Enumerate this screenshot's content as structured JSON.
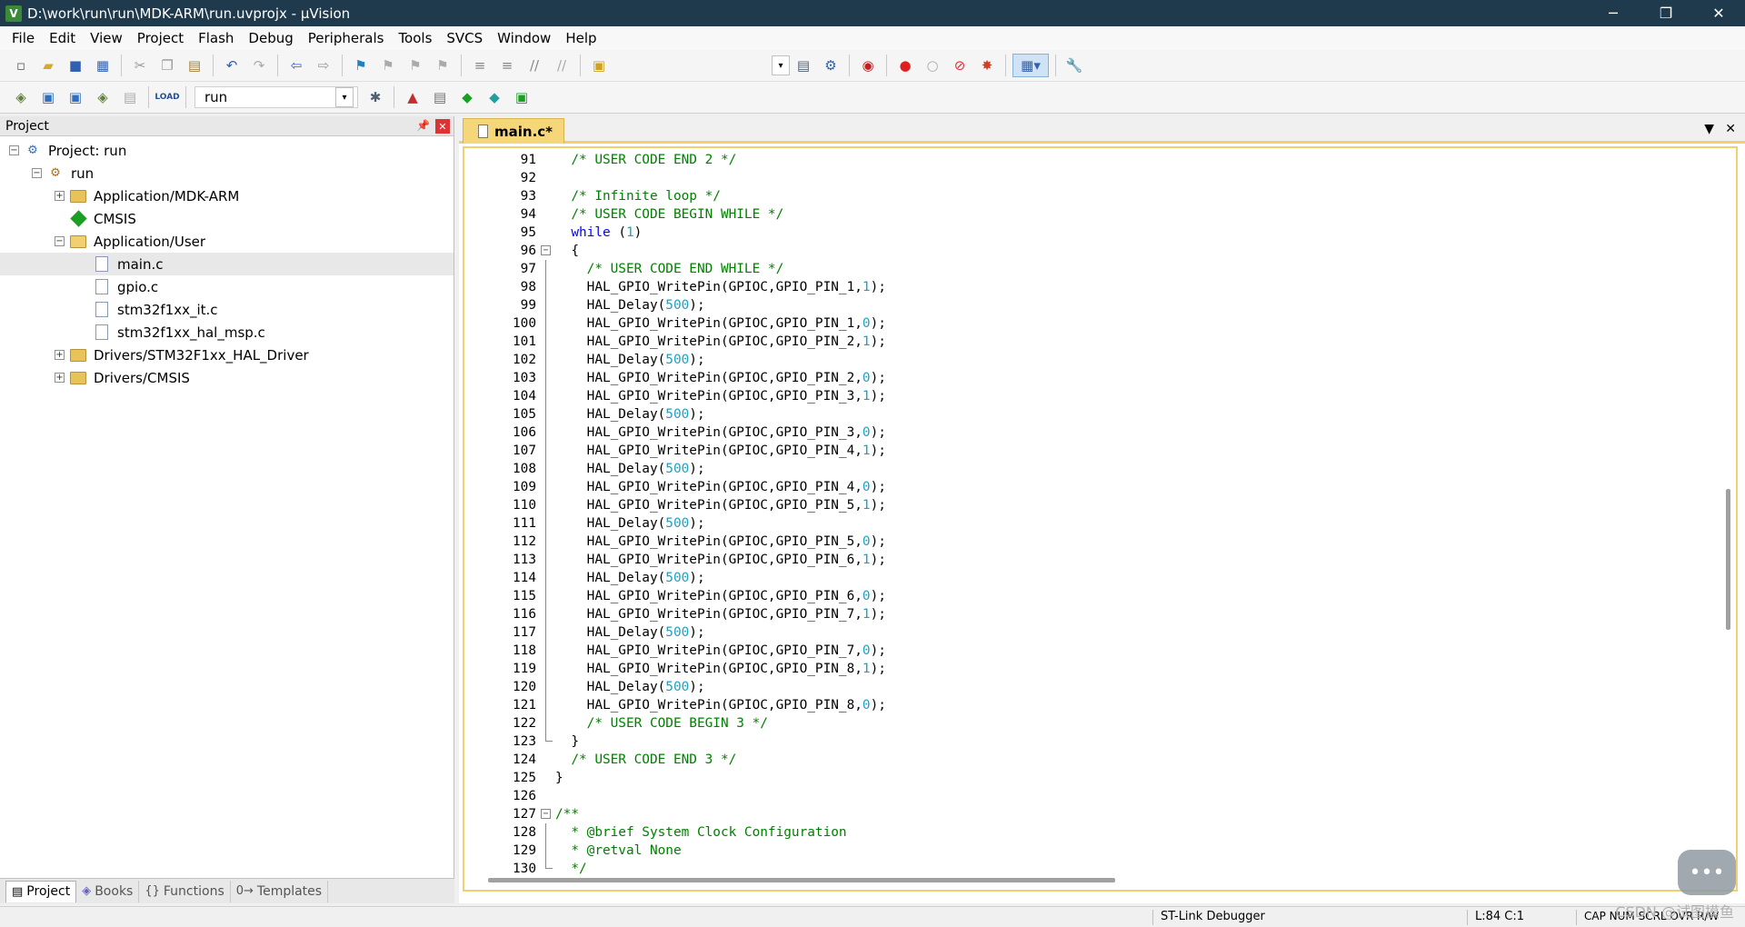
{
  "window": {
    "title": "D:\\work\\run\\run\\MDK-ARM\\run.uvprojx - µVision",
    "minimize": "─",
    "restore": "❐",
    "close": "✕"
  },
  "menu": [
    "File",
    "Edit",
    "View",
    "Project",
    "Flash",
    "Debug",
    "Peripherals",
    "Tools",
    "SVCS",
    "Window",
    "Help"
  ],
  "toolbar2": {
    "target": "run"
  },
  "project_panel": {
    "title": "Project",
    "pin": "📌",
    "close": "✕",
    "tree": [
      {
        "label": "Project: run",
        "level": 0,
        "expander": "−",
        "icon": "project"
      },
      {
        "label": "run",
        "level": 1,
        "expander": "−",
        "icon": "target"
      },
      {
        "label": "Application/MDK-ARM",
        "level": 2,
        "expander": "+",
        "icon": "folder"
      },
      {
        "label": "CMSIS",
        "level": 2,
        "expander": "",
        "icon": "diamond"
      },
      {
        "label": "Application/User",
        "level": 2,
        "expander": "−",
        "icon": "folder-open"
      },
      {
        "label": "main.c",
        "level": 3,
        "expander": "",
        "icon": "file",
        "selected": true
      },
      {
        "label": "gpio.c",
        "level": 3,
        "expander": "",
        "icon": "file"
      },
      {
        "label": "stm32f1xx_it.c",
        "level": 3,
        "expander": "",
        "icon": "file"
      },
      {
        "label": "stm32f1xx_hal_msp.c",
        "level": 3,
        "expander": "",
        "icon": "file"
      },
      {
        "label": "Drivers/STM32F1xx_HAL_Driver",
        "level": 2,
        "expander": "+",
        "icon": "folder"
      },
      {
        "label": "Drivers/CMSIS",
        "level": 2,
        "expander": "+",
        "icon": "folder"
      }
    ],
    "tabs": [
      {
        "label": "Project",
        "icon": "▤"
      },
      {
        "label": "Books",
        "icon": "◈"
      },
      {
        "label": "Functions",
        "icon": "{}"
      },
      {
        "label": "Templates",
        "icon": "0→"
      }
    ]
  },
  "editor": {
    "tab_label": "main.c*",
    "lines": [
      {
        "n": "91",
        "t": "  /* USER CODE END 2 */"
      },
      {
        "n": "92",
        "t": ""
      },
      {
        "n": "93",
        "t": "  /* Infinite loop */"
      },
      {
        "n": "94",
        "t": "  /* USER CODE BEGIN WHILE */"
      },
      {
        "n": "95",
        "t": "  while (1)"
      },
      {
        "n": "96",
        "t": "  {"
      },
      {
        "n": "97",
        "t": "    /* USER CODE END WHILE */"
      },
      {
        "n": "98",
        "t": "    HAL_GPIO_WritePin(GPIOC,GPIO_PIN_1,1);"
      },
      {
        "n": "99",
        "t": "    HAL_Delay(500);"
      },
      {
        "n": "100",
        "t": "    HAL_GPIO_WritePin(GPIOC,GPIO_PIN_1,0);"
      },
      {
        "n": "101",
        "t": "    HAL_GPIO_WritePin(GPIOC,GPIO_PIN_2,1);"
      },
      {
        "n": "102",
        "t": "    HAL_Delay(500);"
      },
      {
        "n": "103",
        "t": "    HAL_GPIO_WritePin(GPIOC,GPIO_PIN_2,0);"
      },
      {
        "n": "104",
        "t": "    HAL_GPIO_WritePin(GPIOC,GPIO_PIN_3,1);"
      },
      {
        "n": "105",
        "t": "    HAL_Delay(500);"
      },
      {
        "n": "106",
        "t": "    HAL_GPIO_WritePin(GPIOC,GPIO_PIN_3,0);"
      },
      {
        "n": "107",
        "t": "    HAL_GPIO_WritePin(GPIOC,GPIO_PIN_4,1);"
      },
      {
        "n": "108",
        "t": "    HAL_Delay(500);"
      },
      {
        "n": "109",
        "t": "    HAL_GPIO_WritePin(GPIOC,GPIO_PIN_4,0);"
      },
      {
        "n": "110",
        "t": "    HAL_GPIO_WritePin(GPIOC,GPIO_PIN_5,1);"
      },
      {
        "n": "111",
        "t": "    HAL_Delay(500);"
      },
      {
        "n": "112",
        "t": "    HAL_GPIO_WritePin(GPIOC,GPIO_PIN_5,0);"
      },
      {
        "n": "113",
        "t": "    HAL_GPIO_WritePin(GPIOC,GPIO_PIN_6,1);"
      },
      {
        "n": "114",
        "t": "    HAL_Delay(500);"
      },
      {
        "n": "115",
        "t": "    HAL_GPIO_WritePin(GPIOC,GPIO_PIN_6,0);"
      },
      {
        "n": "116",
        "t": "    HAL_GPIO_WritePin(GPIOC,GPIO_PIN_7,1);"
      },
      {
        "n": "117",
        "t": "    HAL_Delay(500);"
      },
      {
        "n": "118",
        "t": "    HAL_GPIO_WritePin(GPIOC,GPIO_PIN_7,0);"
      },
      {
        "n": "119",
        "t": "    HAL_GPIO_WritePin(GPIOC,GPIO_PIN_8,1);"
      },
      {
        "n": "120",
        "t": "    HAL_Delay(500);"
      },
      {
        "n": "121",
        "t": "    HAL_GPIO_WritePin(GPIOC,GPIO_PIN_8,0);"
      },
      {
        "n": "122",
        "t": "    /* USER CODE BEGIN 3 */"
      },
      {
        "n": "123",
        "t": "  }"
      },
      {
        "n": "124",
        "t": "  /* USER CODE END 3 */"
      },
      {
        "n": "125",
        "t": "}"
      },
      {
        "n": "126",
        "t": ""
      },
      {
        "n": "127",
        "t": "/**"
      },
      {
        "n": "128",
        "t": "  * @brief System Clock Configuration"
      },
      {
        "n": "129",
        "t": "  * @retval None"
      },
      {
        "n": "130",
        "t": "  */"
      }
    ]
  },
  "status": {
    "debugger": "ST-Link Debugger",
    "position": "L:84 C:1",
    "indicators": "CAP  NUM  SCRL  OVR  R/W"
  },
  "watermark": "CSDN @试图摸鱼",
  "colors": {
    "titlebar": "#1e3a4c",
    "comment": "#008000",
    "keyword": "#0000ff",
    "number": "#20a0c0",
    "tab_active": "#f5d77a"
  }
}
